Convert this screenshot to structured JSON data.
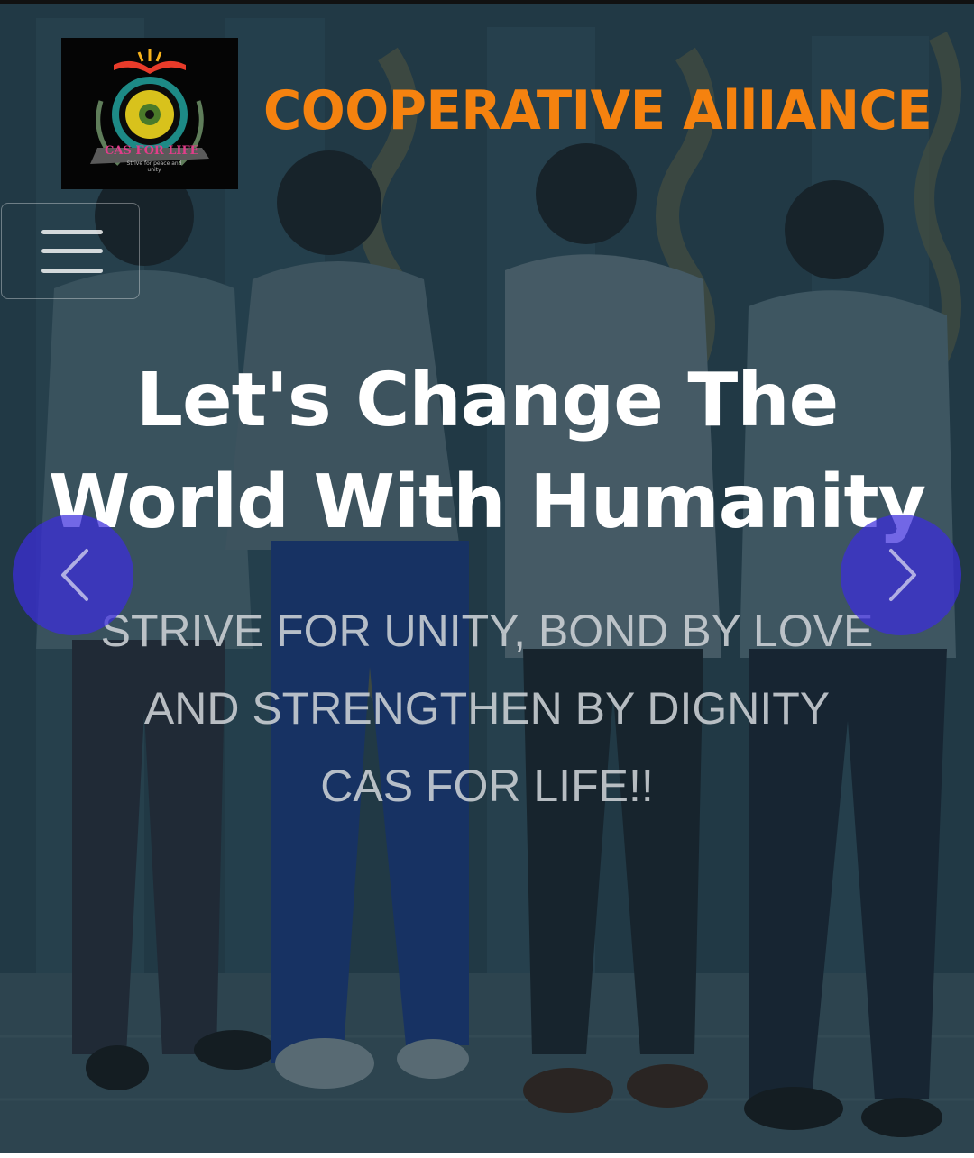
{
  "header": {
    "brand_title": "COOPERATIVE AllIANCE",
    "logo": {
      "text": "CAS FOR LIFE",
      "motto": "Strive for peace and unity",
      "colors": [
        "#e83b2a",
        "#f7b21b",
        "#2a9a8c",
        "#6ec04a",
        "#8b3fb6"
      ]
    },
    "menu_icon": "hamburger-icon"
  },
  "hero": {
    "headline_line1": "Let's Change The",
    "headline_line2": "World With Humanity",
    "subtitle_line1": "STRIVE FOR UNITY, BOND BY LOVE",
    "subtitle_line2": "AND STRENGTHEN BY DIGNITY",
    "subtitle_line3": "CAS FOR LIFE!!"
  },
  "carousel": {
    "prev_icon": "chevron-left-icon",
    "next_icon": "chevron-right-icon"
  },
  "colors": {
    "brand_orange": "#f5820f",
    "overlay": "#233a47",
    "carousel_button": "#3c2cdc"
  }
}
